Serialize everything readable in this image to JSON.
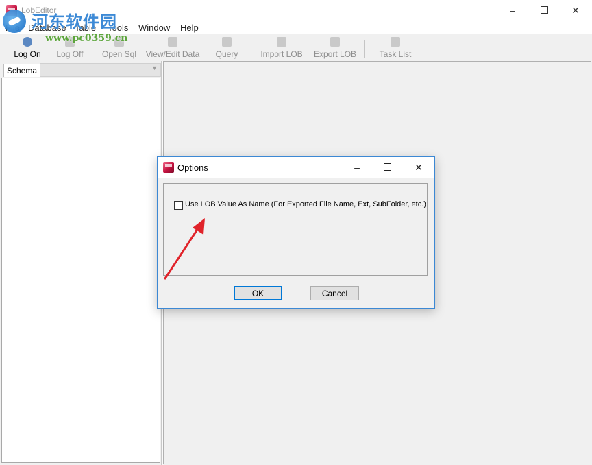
{
  "window": {
    "title": "LobEditor",
    "minimize": "–",
    "close": "✕"
  },
  "watermark": {
    "site_cn": "河东软件园",
    "site_url": "www.pc0359.cn"
  },
  "menu": {
    "items": [
      "File",
      "Database",
      "Table",
      "Tools",
      "Window",
      "Help"
    ]
  },
  "toolbar": {
    "buttons": [
      {
        "label": "Log On",
        "icon": "log-on-icon",
        "enabled": true
      },
      {
        "label": "Log Off",
        "icon": "log-off-icon",
        "enabled": false
      },
      {
        "label": "Open Sql",
        "icon": "open-sql-icon",
        "enabled": false
      },
      {
        "label": "View/Edit Data",
        "icon": "edit-data-icon",
        "enabled": false
      },
      {
        "label": "Query",
        "icon": "query-icon",
        "enabled": false
      },
      {
        "label": "Import LOB",
        "icon": "import-icon",
        "enabled": false
      },
      {
        "label": "Export LOB",
        "icon": "export-icon",
        "enabled": false
      },
      {
        "label": "Task List",
        "icon": "task-list-icon",
        "enabled": false
      }
    ]
  },
  "left_pane": {
    "schema_label": "Schema",
    "schema_value": ""
  },
  "dialog": {
    "title": "Options",
    "minimize": "–",
    "close": "✕",
    "checkbox_label": "Use LOB Value As Name (For Exported File Name, Ext, SubFolder, etc.)",
    "checkbox_checked": false,
    "ok_label": "OK",
    "cancel_label": "Cancel"
  },
  "colors": {
    "accent": "#3c88d4",
    "annotation_arrow": "#e0232a"
  }
}
